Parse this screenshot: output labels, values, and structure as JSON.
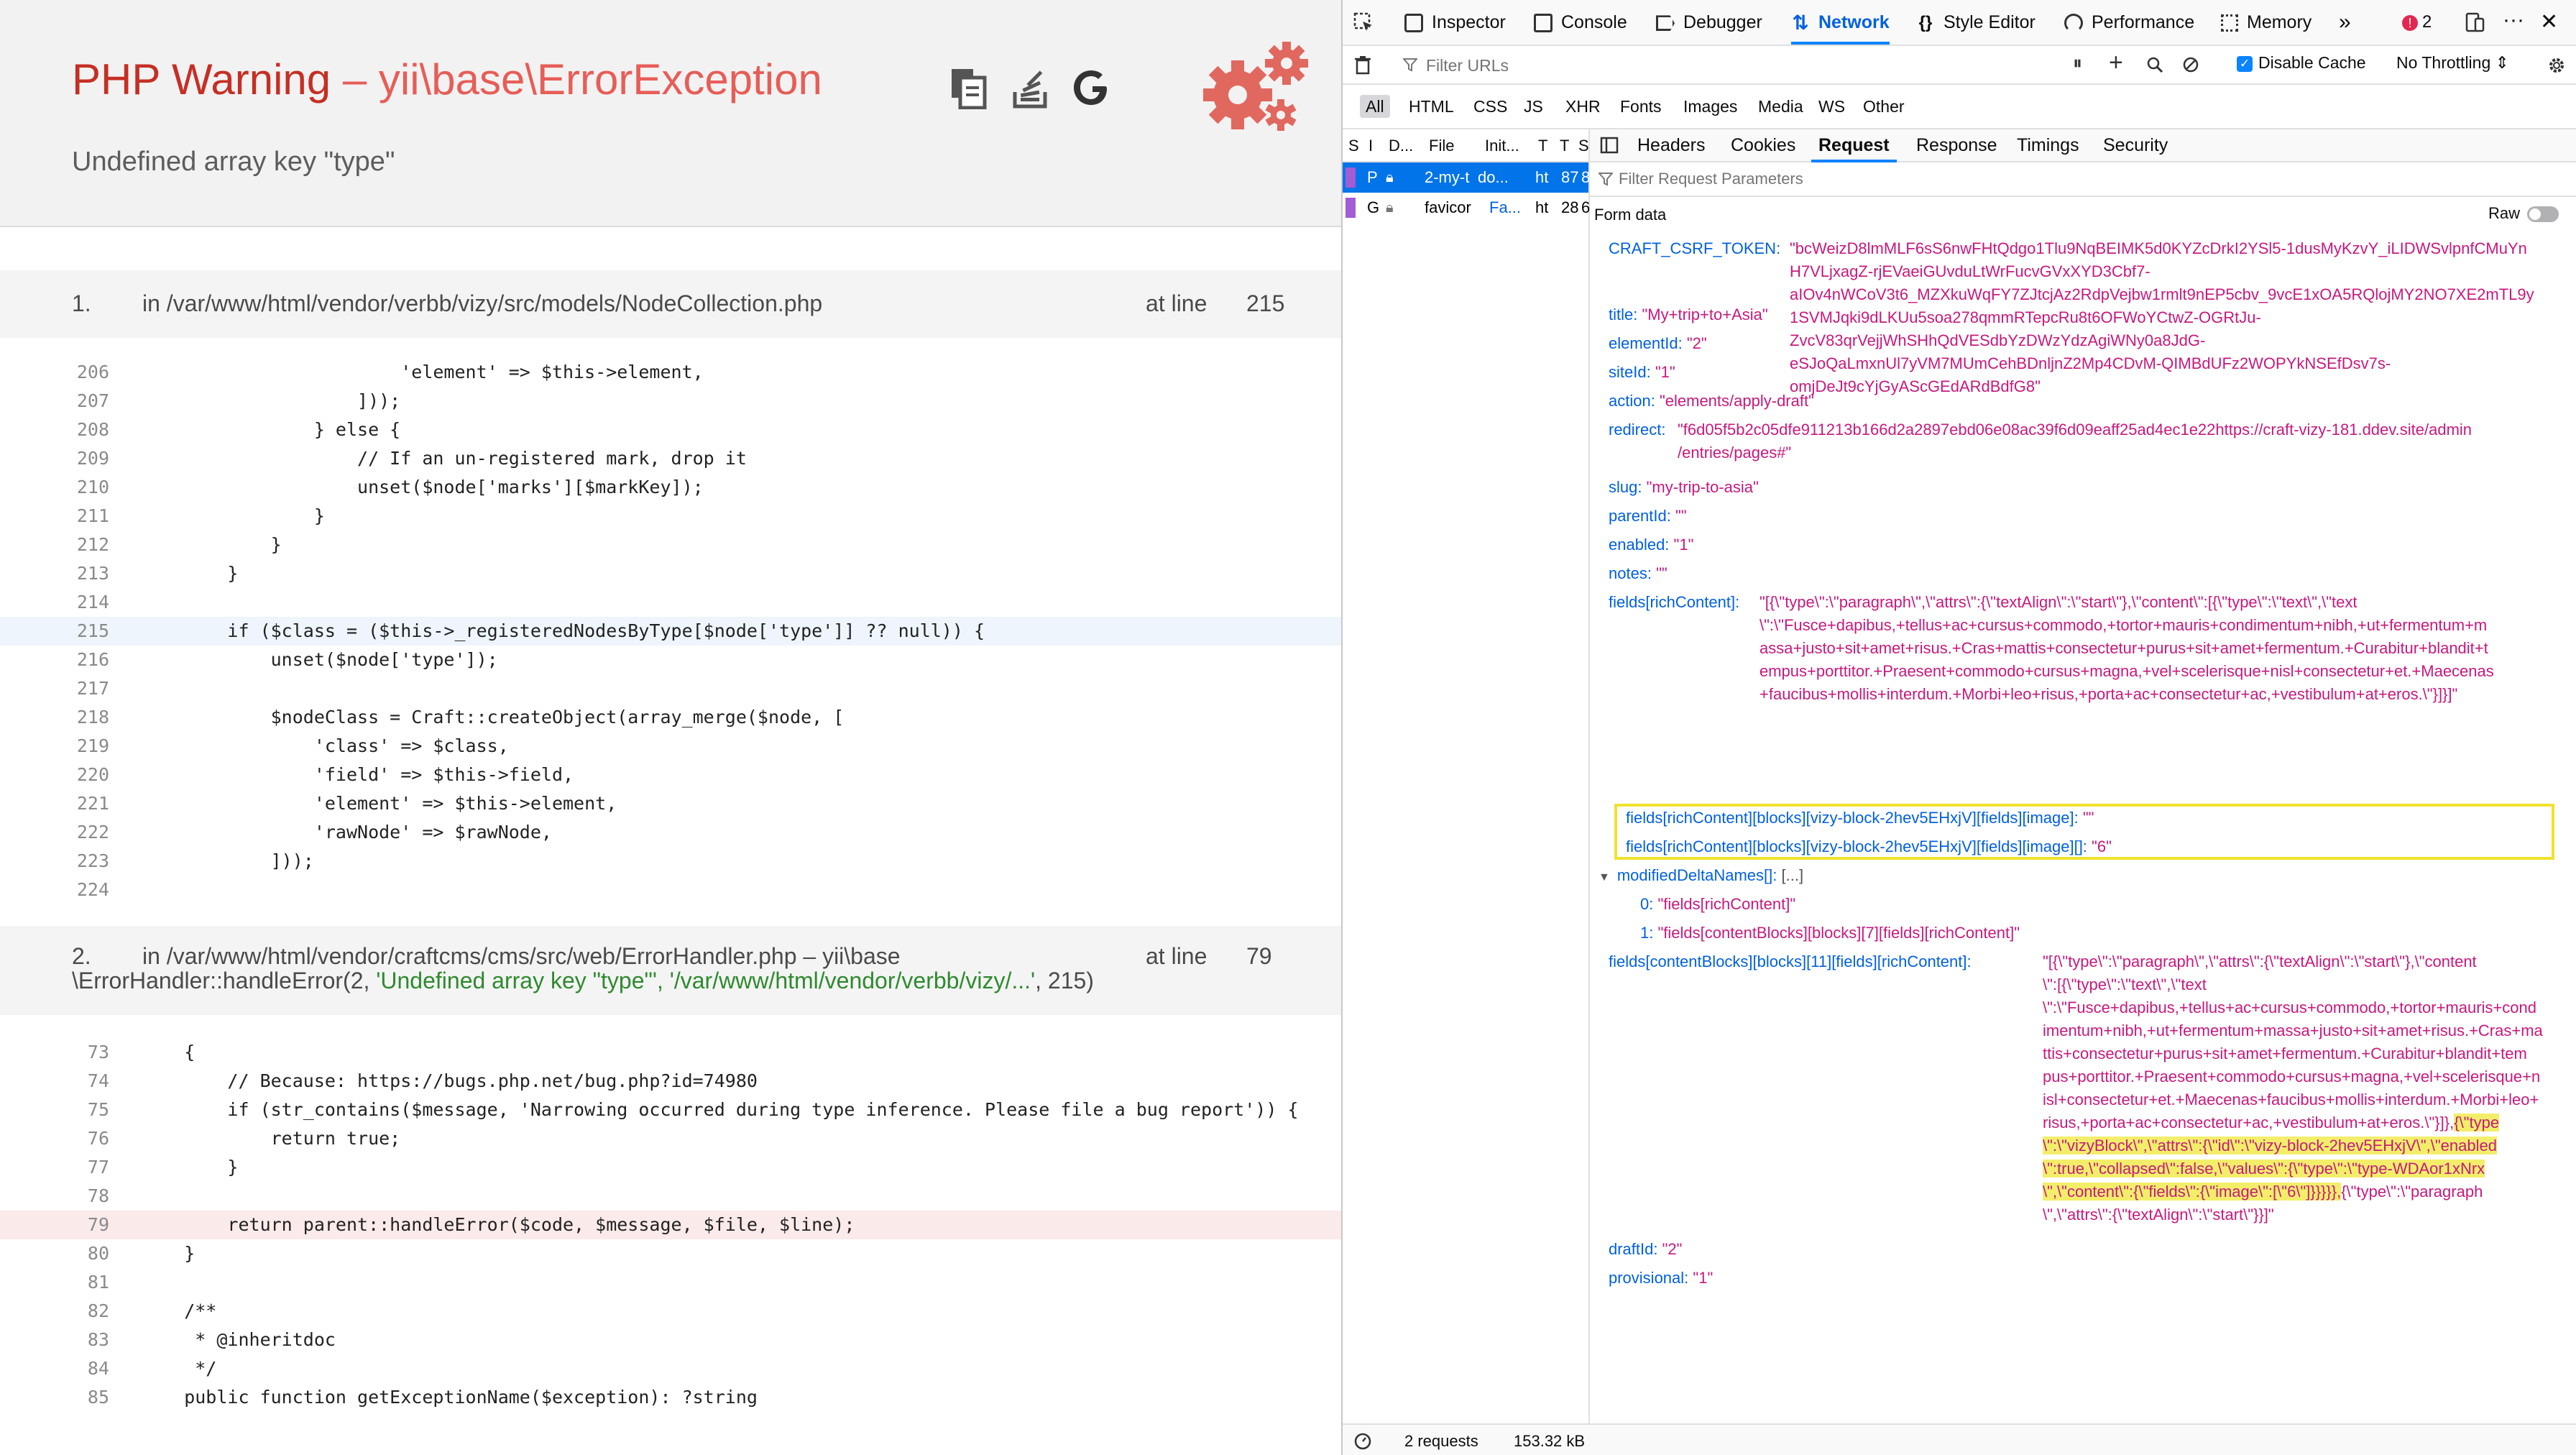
{
  "error": {
    "title_type": "PHP Warning",
    "title_sep": "–",
    "title_class": "yii\\base\\ErrorException",
    "message": "Undefined array key \"type\"",
    "icons": [
      "copy-icon",
      "stackoverflow-icon",
      "google-icon",
      "gears-icon"
    ]
  },
  "frames": [
    {
      "num": "1.",
      "file": "in /var/www/html/vendor/verbb/vizy/src/models/NodeCollection.php",
      "at_line_label": "at line",
      "line": "215",
      "code": [
        {
          "n": "206",
          "t": "                        'element' => $this->element,"
        },
        {
          "n": "207",
          "t": "                    ]));"
        },
        {
          "n": "208",
          "t": "                } else {"
        },
        {
          "n": "209",
          "t": "                    // If an un-registered mark, drop it"
        },
        {
          "n": "210",
          "t": "                    unset($node['marks'][$markKey]);"
        },
        {
          "n": "211",
          "t": "                }"
        },
        {
          "n": "212",
          "t": "            }"
        },
        {
          "n": "213",
          "t": "        }"
        },
        {
          "n": "214",
          "t": ""
        },
        {
          "n": "215",
          "t": "        if ($class = ($this->_registeredNodesByType[$node['type']] ?? null)) {"
        },
        {
          "n": "216",
          "t": "            unset($node['type']);"
        },
        {
          "n": "217",
          "t": ""
        },
        {
          "n": "218",
          "t": "            $nodeClass = Craft::createObject(array_merge($node, ["
        },
        {
          "n": "219",
          "t": "                'class' => $class,"
        },
        {
          "n": "220",
          "t": "                'field' => $this->field,"
        },
        {
          "n": "221",
          "t": "                'element' => $this->element,"
        },
        {
          "n": "222",
          "t": "                'rawNode' => $rawNode,"
        },
        {
          "n": "223",
          "t": "            ]));"
        },
        {
          "n": "224",
          "t": ""
        }
      ]
    },
    {
      "num": "2.",
      "file_line1": "in /var/www/html/vendor/craftcms/cms/src/web/ErrorHandler.php – yii\\base",
      "file_line2_a": "\\ErrorHandler::handleError(2, ",
      "file_line2_b": "'Undefined array key \"type\"', '/var/www/html/vendor/verbb/vizy/...'",
      "file_line2_c": ", 215)",
      "at_line_label": "at line",
      "line": "79",
      "code": [
        {
          "n": "73",
          "t": "    {"
        },
        {
          "n": "74",
          "t": "        // Because: https://bugs.php.net/bug.php?id=74980"
        },
        {
          "n": "75",
          "t": "        if (str_contains($message, 'Narrowing occurred during type inference. Please file a bug report')) {"
        },
        {
          "n": "76",
          "t": "            return true;"
        },
        {
          "n": "77",
          "t": "        }"
        },
        {
          "n": "78",
          "t": ""
        },
        {
          "n": "79",
          "t": "        return parent::handleError($code, $message, $file, $line);"
        },
        {
          "n": "80",
          "t": "    }"
        },
        {
          "n": "81",
          "t": ""
        },
        {
          "n": "82",
          "t": "    /**"
        },
        {
          "n": "83",
          "t": "     * @inheritdoc"
        },
        {
          "n": "84",
          "t": "     */"
        },
        {
          "n": "85",
          "t": "    public function getExceptionName($exception): ?string"
        }
      ]
    }
  ],
  "devtools": {
    "tabs": [
      "Inspector",
      "Console",
      "Debugger",
      "Network",
      "Style Editor",
      "Performance",
      "Memory"
    ],
    "active_tab": "Network",
    "error_count": "2",
    "filter_placeholder": "Filter URLs",
    "disable_cache": "Disable Cache",
    "throttle": "No Throttling",
    "type_filters": [
      "All",
      "HTML",
      "CSS",
      "JS",
      "XHR",
      "Fonts",
      "Images",
      "Media",
      "WS",
      "Other"
    ],
    "req_cols": [
      "S",
      "I",
      "D...",
      "File",
      "Init...",
      "T",
      "T",
      "S"
    ],
    "requests": [
      {
        "m": "P",
        "file": "2-my-t",
        "init": "do...",
        "t": "ht",
        "s": "87",
        "z": "8"
      },
      {
        "m": "G",
        "file": "favicor",
        "init": "Fa...",
        "t": "ht",
        "s": "28",
        "z": "6"
      }
    ],
    "detail_tabs": [
      "Headers",
      "Cookies",
      "Request",
      "Response",
      "Timings",
      "Security"
    ],
    "active_detail_tab": "Request",
    "param_filter_placeholder": "Filter Request Parameters",
    "form_data_label": "Form data",
    "raw_label": "Raw",
    "params": {
      "csrf_key": "CRAFT_CSRF_TOKEN:",
      "csrf_lines": [
        "\"bcWeizD8lmMLF6sS6nwFHtQdgo1Tlu9NqBEIMK5d0KYZcDrkI2YSl5-1dusMyKzvY_iLIDWSvlpnfCMuYn",
        "H7VLjxagZ-rjEVaeiGUvduLtWrFucvGVxXYD3Cbf7-",
        "aIOv4nWCoV3t6_MZXkuWqFY7ZJtcjAz2RdpVejbw1rmlt9nEP5cbv_9vcE1xOA5RQlojMY2NO7XE2mTL9y",
        "1SVMJqki9dLKUu5soa278qmmRTepcRu8t6OFWoYCtwZ-OGRtJu-",
        "ZvcV83qrVejjWhSHhQdVESdbYzDWzYdzAgiWNy0a8JdG-",
        "eSJoQaLmxnUl7yVM7MUmCehBDnljnZ2Mp4CDvM-QIMBdUFz2WOPYkNSEfDsv7s-",
        "omjDeJt9cYjGyAScGEdARdBdfG8\""
      ],
      "title_k": "title:",
      "title_v": "\"My+trip+to+Asia\"",
      "elementId_k": "elementId:",
      "elementId_v": "\"2\"",
      "siteId_k": "siteId:",
      "siteId_v": "\"1\"",
      "action_k": "action:",
      "action_v": "\"elements/apply-draft\"",
      "redirect_k": "redirect:",
      "redirect_lines": [
        "\"f6d05f5b2c05dfe911213b166d2a2897ebd06e08ac39f6d09eaff25ad4ec1e22https://craft-vizy-181.ddev.site/admin",
        "/entries/pages#\""
      ],
      "slug_k": "slug:",
      "slug_v": "\"my-trip-to-asia\"",
      "parentId_k": "parentId:",
      "parentId_v": "\"\"",
      "enabled_k": "enabled:",
      "enabled_v": "\"1\"",
      "notes_k": "notes:",
      "notes_v": "\"\"",
      "rich_k": "fields[richContent]:",
      "rich_lines": [
        "\"[{\\\"type\\\":\\\"paragraph\\\",\\\"attrs\\\":{\\\"textAlign\\\":\\\"start\\\"},\\\"content\\\":[{\\\"type\\\":\\\"text\\\",\\\"text",
        "\\\":\\\"Fusce+dapibus,+tellus+ac+cursus+commodo,+tortor+mauris+condimentum+nibh,+ut+fermentum+m",
        "assa+justo+sit+amet+risus.+Cras+mattis+consectetur+purus+sit+amet+fermentum.+Curabitur+blandit+t",
        "empus+porttitor.+Praesent+commodo+cursus+magna,+vel+scelerisque+nisl+consectetur+et.+Maecenas",
        "+faucibus+mollis+interdum.+Morbi+leo+risus,+porta+ac+consectetur+ac,+vestibulum+at+eros.\\\"}]}]\""
      ],
      "img_k": "fields[richContent][blocks][vizy-block-2hev5EHxjV][fields][image]:",
      "img_v": "\"\"",
      "img2_k": "fields[richContent][blocks][vizy-block-2hev5EHxjV][fields][image][]:",
      "img2_v": "\"6\"",
      "mod_k": "modifiedDeltaNames[]:",
      "mod_v": "[...]",
      "mod0_k": "0:",
      "mod0_v": "\"fields[richContent]\"",
      "mod1_k": "1:",
      "mod1_v": "\"fields[contentBlocks][blocks][7][fields][richContent]\"",
      "cb_k": "fields[contentBlocks][blocks][11][fields][richContent]:",
      "cb_lines": [
        "\"[{\\\"type\\\":\\\"paragraph\\\",\\\"attrs\\\":{\\\"textAlign\\\":\\\"start\\\"},\\\"content",
        "\\\":[{\\\"type\\\":\\\"text\\\",\\\"text",
        "\\\":\\\"Fusce+dapibus,+tellus+ac+cursus+commodo,+tortor+mauris+cond",
        "imentum+nibh,+ut+fermentum+massa+justo+sit+amet+risus.+Cras+ma",
        "ttis+consectetur+purus+sit+amet+fermentum.+Curabitur+blandit+tem",
        "pus+porttitor.+Praesent+commodo+cursus+magna,+vel+scelerisque+n",
        "isl+consectetur+et.+Maecenas+faucibus+mollis+interdum.+Morbi+leo+",
        "risus,+porta+ac+consectetur+ac,+vestibulum+at+eros.\\\"}]},"
      ],
      "cb_hl_1": "{\\\"type",
      "cb_hl_lines": [
        "\\\":\\\"vizyBlock\\\",\\\"attrs\\\":{\\\"id\\\":\\\"vizy-block-2hev5EHxjV\\\",\\\"enabled",
        "\\\":true,\\\"collapsed\\\":false,\\\"values\\\":{\\\"type\\\":\\\"type-WDAor1xNrx",
        "\\\",\\\"content\\\":{\\\"fields\\\":{\\\"image\\\":[\\\"6\\\"]}}}}},"
      ],
      "cb_tail_1": "{\\\"type\\\":\\\"paragraph",
      "cb_tail_2": "\\\",\\\"attrs\\\":{\\\"textAlign\\\":\\\"start\\\"}}]\"",
      "draft_k": "draftId:",
      "draft_v": "\"2\"",
      "prov_k": "provisional:",
      "prov_v": "\"1\""
    },
    "status_requests": "2 requests",
    "status_size": "153.32 kB"
  }
}
